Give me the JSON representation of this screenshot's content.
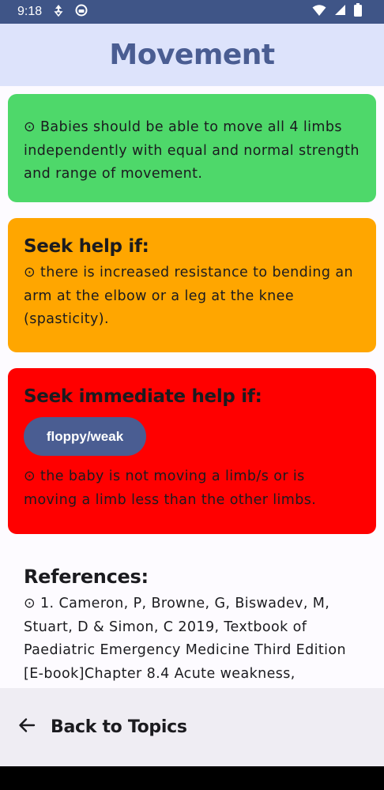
{
  "status_bar": {
    "time": "9:18",
    "icons": [
      "data-saver-icon",
      "app-notification-icon",
      "wifi-icon",
      "cellular-signal-icon",
      "battery-icon"
    ]
  },
  "header": {
    "title": "Movement"
  },
  "cards": {
    "normal": {
      "text": "⊙ Babies should be able to move all 4 limbs independently with equal and normal strength and range of movement.",
      "color": "#4ed86a"
    },
    "seek_help": {
      "heading": "Seek help if:",
      "text": "⊙ there is increased resistance to bending an arm at the elbow or a leg at the knee (spasticity).",
      "color": "#ffa600"
    },
    "seek_immediate_help": {
      "heading": "Seek immediate help if:",
      "chip_label": "floppy/weak",
      "text": "⊙ the baby is not moving a limb/s or is moving a limb less than the other limbs.",
      "color": "#ff0000"
    }
  },
  "references": {
    "heading": "References:",
    "text": "⊙ 1. Cameron, P, Browne, G, Biswadev, M, Stuart, D & Simon, C 2019, Textbook of Paediatric Emergency Medicine Third Edition [E-book]Chapter 8.4 Acute weakness,"
  },
  "bottom_bar": {
    "back_label": "Back to Topics",
    "icon": "arrow-back-icon"
  },
  "colors": {
    "status_bar": "#3f5587",
    "app_bar": "#dde3fb",
    "accent": "#4a5d92",
    "bottom_bar": "#efedf3"
  }
}
